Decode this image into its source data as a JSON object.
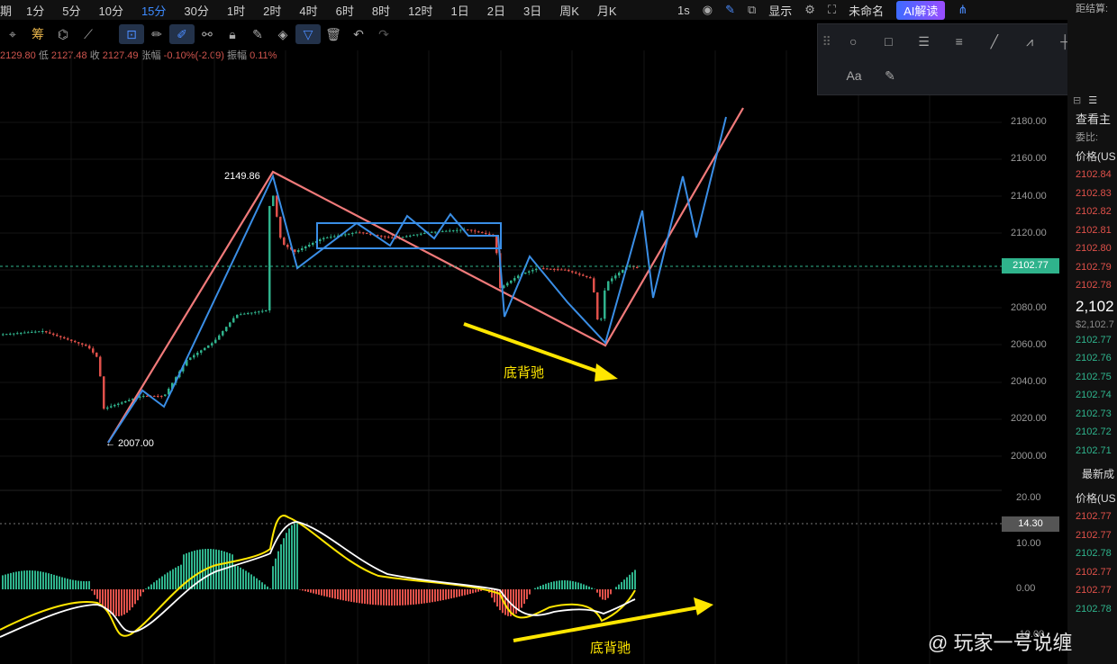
{
  "timeframes": [
    "期",
    "1分",
    "5分",
    "10分",
    "15分",
    "30分",
    "1时",
    "2时",
    "4时",
    "6时",
    "8时",
    "12时",
    "1日",
    "2日",
    "3日",
    "周K",
    "月K"
  ],
  "active_timeframe": "15分",
  "top_right": {
    "interval": "1s",
    "display_label": "显示",
    "layout_name": "未命名",
    "ai_label": "AI解读"
  },
  "ohlc": {
    "high": "2129.80",
    "low_label": "低",
    "low": "2127.48",
    "close_label": "收",
    "close": "2127.49",
    "change_label": "张幅",
    "change": "-0.10%(-2.09)",
    "amp_label": "振幅",
    "amp": "0.11%"
  },
  "price_axis": [
    "2180.00",
    "2160.00",
    "2140.00",
    "2120.00",
    "2100.00",
    "2080.00",
    "2060.00",
    "2040.00",
    "2020.00",
    "2000.00"
  ],
  "current_price": "2102.77",
  "macd_axis": [
    "20.00",
    "10.00",
    "0.00",
    "-10.00"
  ],
  "macd_value": "14.30",
  "chart_labels": {
    "high_point": "2149.86",
    "low_point": "← 2007.00"
  },
  "annotations": {
    "divergence_top": "底背驰",
    "divergence_bottom": "底背驰"
  },
  "watermark": "@ 玩家一号说缠",
  "right_panel": {
    "header_top": "距结算:",
    "view_label": "查看主",
    "ratio_label": "委比:",
    "price_header": "价格(US",
    "asks": [
      "2102.84",
      "2102.83",
      "2102.82",
      "2102.81",
      "2102.80",
      "2102.79",
      "2102.78"
    ],
    "big_price": "2,102",
    "big_sub": "$2,102.7",
    "bids": [
      "2102.77",
      "2102.76",
      "2102.75",
      "2102.74",
      "2102.73",
      "2102.72",
      "2102.71"
    ],
    "latest_label": "最新成",
    "price_header2": "价格(US",
    "trades": [
      {
        "price": "2102.77",
        "side": "sell"
      },
      {
        "price": "2102.77",
        "side": "sell"
      },
      {
        "price": "2102.78",
        "side": "buy"
      },
      {
        "price": "2102.77",
        "side": "sell"
      },
      {
        "price": "2102.77",
        "side": "sell"
      },
      {
        "price": "2102.78",
        "side": "buy"
      }
    ]
  },
  "colors": {
    "up": "#2fb38c",
    "down": "#e0514a",
    "red_line": "#f07a7a",
    "blue_line": "#3a8ee6",
    "annotation": "#ffe600"
  }
}
